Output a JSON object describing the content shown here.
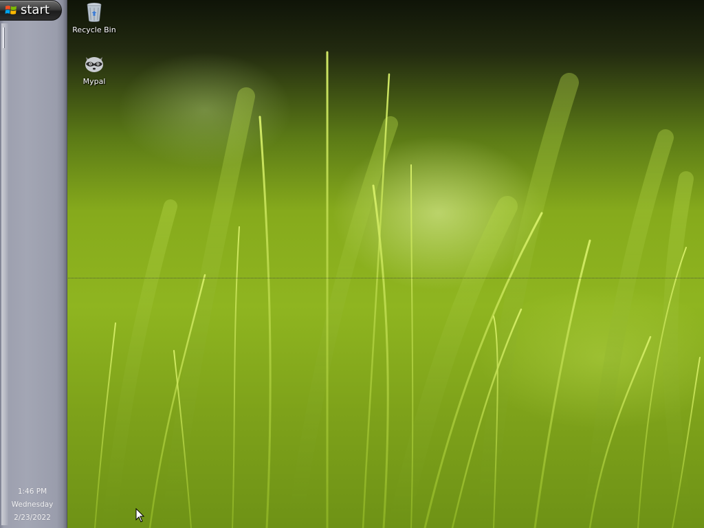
{
  "taskbar": {
    "start_label": "start",
    "clock": {
      "time": "1:46 PM",
      "day": "Wednesday",
      "date": "2/23/2022"
    }
  },
  "desktop": {
    "icons": [
      {
        "label": "Recycle Bin",
        "icon": "recycle-bin-icon"
      },
      {
        "label": "Mypal",
        "icon": "mypal-raccoon-icon"
      }
    ],
    "wallpaper": "green grass blades, dark top"
  },
  "colors": {
    "taskbar": "#a3a6b4",
    "start_button": "#2c2c2c",
    "grass": "#8fb520",
    "sky": "#0f1408"
  }
}
